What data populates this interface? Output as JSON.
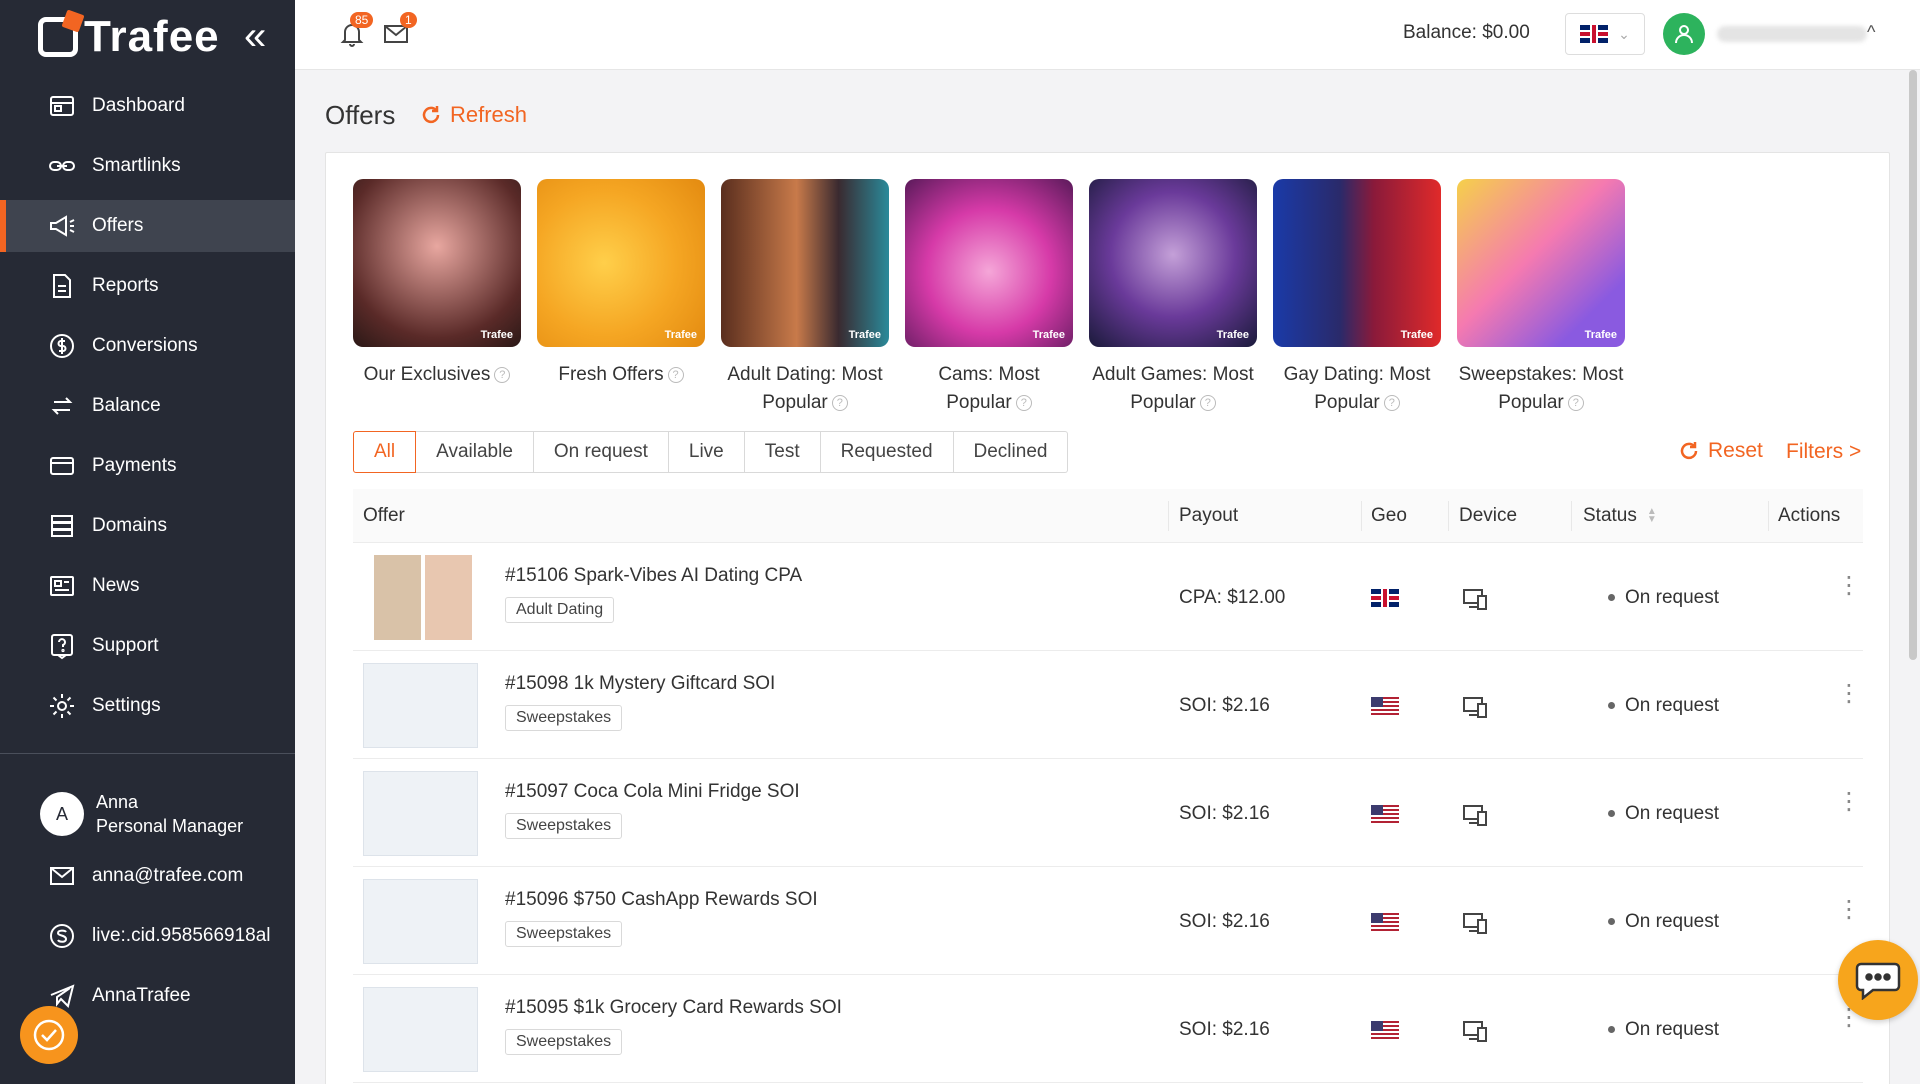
{
  "brand": {
    "name": "Trafee"
  },
  "sidebar": {
    "items": [
      {
        "label": "Dashboard",
        "icon": "dashboard-icon"
      },
      {
        "label": "Smartlinks",
        "icon": "link-icon"
      },
      {
        "label": "Offers",
        "icon": "megaphone-icon",
        "active": true
      },
      {
        "label": "Reports",
        "icon": "document-icon"
      },
      {
        "label": "Conversions",
        "icon": "dollar-circle-icon"
      },
      {
        "label": "Balance",
        "icon": "transfer-icon"
      },
      {
        "label": "Payments",
        "icon": "card-icon"
      },
      {
        "label": "Domains",
        "icon": "server-icon"
      },
      {
        "label": "News",
        "icon": "newspaper-icon"
      },
      {
        "label": "Support",
        "icon": "help-icon"
      },
      {
        "label": "Settings",
        "icon": "gear-icon"
      }
    ],
    "manager": {
      "initial": "A",
      "name": "Anna",
      "role": "Personal Manager",
      "email": "anna@trafee.com",
      "skype": "live:.cid.958566918al",
      "telegram": "AnnaTrafee"
    }
  },
  "topbar": {
    "notifications_count": "85",
    "messages_count": "1",
    "balance": "Balance: $0.00"
  },
  "page": {
    "title": "Offers",
    "refresh_label": "Refresh"
  },
  "categories": [
    {
      "label": "Our Exclusives",
      "watermark": "Trafee"
    },
    {
      "label": "Fresh Offers",
      "watermark": "Trafee"
    },
    {
      "label": "Adult Dating: Most Popular",
      "watermark": "Trafee"
    },
    {
      "label": "Cams: Most Popular",
      "watermark": "Trafee"
    },
    {
      "label": "Adult Games: Most Popular",
      "watermark": "Trafee"
    },
    {
      "label": "Gay Dating: Most Popular",
      "watermark": "Trafee"
    },
    {
      "label": "Sweepstakes: Most Popular",
      "watermark": "Trafee"
    }
  ],
  "tabs": [
    "All",
    "Available",
    "On request",
    "Live",
    "Test",
    "Requested",
    "Declined"
  ],
  "filter_actions": {
    "reset": "Reset",
    "filters": "Filters >"
  },
  "table": {
    "headers": [
      "Offer",
      "Payout",
      "Geo",
      "Device",
      "Status",
      "Actions"
    ],
    "rows": [
      {
        "name": "#15106 Spark-Vibes AI Dating CPA",
        "tag": "Adult Dating",
        "payout": "CPA: $12.00",
        "geo": "uk-flag",
        "status": "On request"
      },
      {
        "name": "#15098 1k Mystery Giftcard SOI",
        "tag": "Sweepstakes",
        "payout": "SOI: $2.16",
        "geo": "us-flag",
        "status": "On request"
      },
      {
        "name": "#15097 Coca Cola Mini Fridge SOI",
        "tag": "Sweepstakes",
        "payout": "SOI: $2.16",
        "geo": "us-flag",
        "status": "On request"
      },
      {
        "name": "#15096 $750 CashApp Rewards SOI",
        "tag": "Sweepstakes",
        "payout": "SOI: $2.16",
        "geo": "us-flag",
        "status": "On request"
      },
      {
        "name": "#15095 $1k Grocery Card Rewards SOI",
        "tag": "Sweepstakes",
        "payout": "SOI: $2.16",
        "geo": "us-flag",
        "status": "On request"
      }
    ]
  },
  "colors": {
    "accent": "#f26522",
    "sidebar_bg": "#262a35",
    "active_bg": "#3f444f"
  }
}
